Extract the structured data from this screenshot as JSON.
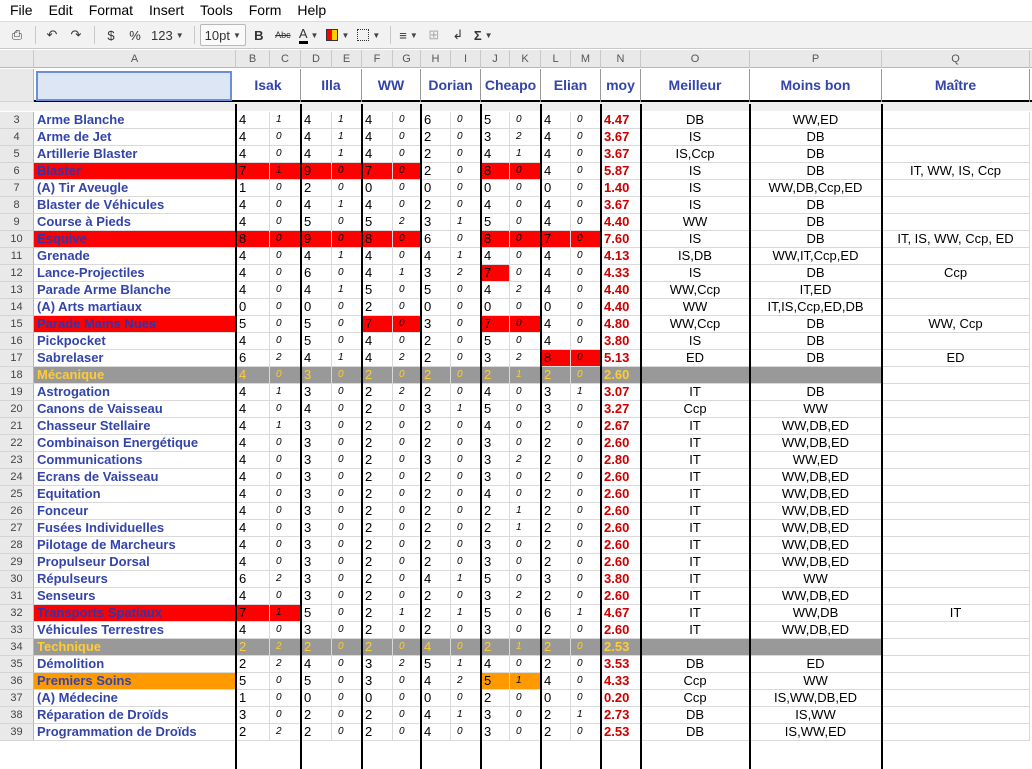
{
  "menu": [
    "File",
    "Edit",
    "Format",
    "Insert",
    "Tools",
    "Form",
    "Help"
  ],
  "toolbar": {
    "currency": "$",
    "percent": "%",
    "format": "123",
    "font_size": "10pt"
  },
  "columns": [
    "A",
    "B",
    "C",
    "D",
    "E",
    "F",
    "G",
    "H",
    "I",
    "J",
    "K",
    "L",
    "M",
    "N",
    "O",
    "P",
    "Q"
  ],
  "headers": {
    "isak": "Isak",
    "illa": "Illa",
    "ww": "WW",
    "dorian": "Dorian",
    "cheapo": "Cheapo",
    "elian": "Elian",
    "moy": "moy",
    "meilleur": "Meilleur",
    "moins_bon": "Moins bon",
    "maitre": "Maître"
  },
  "colors": {
    "red": "#ff0000",
    "gray": "#999999",
    "orange": "#ff9900",
    "name_blue": "#3344aa",
    "cat_yellow": "#ffcc33",
    "moy_red": "#cc0000"
  },
  "rows": [
    {
      "n": "3",
      "name": "Arme Blanche",
      "v": [
        "4",
        "1",
        "4",
        "1",
        "4",
        "0",
        "6",
        "0",
        "5",
        "0",
        "4",
        "0"
      ],
      "moy": "4.47",
      "best": "DB",
      "worst": "WW,ED",
      "master": ""
    },
    {
      "n": "4",
      "name": "Arme de Jet",
      "v": [
        "4",
        "0",
        "4",
        "1",
        "4",
        "0",
        "2",
        "0",
        "3",
        "2",
        "4",
        "0"
      ],
      "moy": "3.67",
      "best": "IS",
      "worst": "DB",
      "master": ""
    },
    {
      "n": "5",
      "name": "Artillerie Blaster",
      "v": [
        "4",
        "0",
        "4",
        "1",
        "4",
        "0",
        "2",
        "0",
        "4",
        "1",
        "4",
        "0"
      ],
      "moy": "3.67",
      "best": "IS,Ccp",
      "worst": "DB",
      "master": ""
    },
    {
      "n": "6",
      "name": "Blaster",
      "v": [
        "7",
        "1",
        "9",
        "0",
        "7",
        "0",
        "2",
        "0",
        "8",
        "0",
        "4",
        "0"
      ],
      "moy": "5.87",
      "best": "IS",
      "worst": "DB",
      "master": "IT, WW, IS, Ccp",
      "style": "red",
      "hl": [
        0,
        1,
        2,
        3,
        4,
        5,
        8,
        9
      ]
    },
    {
      "n": "7",
      "name": "(A) Tir Aveugle",
      "v": [
        "1",
        "0",
        "2",
        "0",
        "0",
        "0",
        "0",
        "0",
        "0",
        "0",
        "0",
        "0"
      ],
      "moy": "1.40",
      "best": "IS",
      "worst": "WW,DB,Ccp,ED",
      "master": ""
    },
    {
      "n": "8",
      "name": "Blaster de Véhicules",
      "v": [
        "4",
        "0",
        "4",
        "1",
        "4",
        "0",
        "2",
        "0",
        "4",
        "0",
        "4",
        "0"
      ],
      "moy": "3.67",
      "best": "IS",
      "worst": "DB",
      "master": ""
    },
    {
      "n": "9",
      "name": "Course à Pieds",
      "v": [
        "4",
        "0",
        "5",
        "0",
        "5",
        "2",
        "3",
        "1",
        "5",
        "0",
        "4",
        "0"
      ],
      "moy": "4.40",
      "best": "WW",
      "worst": "DB",
      "master": ""
    },
    {
      "n": "10",
      "name": "Esquive",
      "v": [
        "8",
        "0",
        "9",
        "0",
        "8",
        "0",
        "6",
        "0",
        "8",
        "0",
        "7",
        "0"
      ],
      "moy": "7.60",
      "best": "IS",
      "worst": "DB",
      "master": "IT, IS, WW, Ccp, ED",
      "style": "red",
      "hl": [
        0,
        1,
        2,
        3,
        4,
        5,
        8,
        9,
        10,
        11
      ]
    },
    {
      "n": "11",
      "name": "Grenade",
      "v": [
        "4",
        "0",
        "4",
        "1",
        "4",
        "0",
        "4",
        "1",
        "4",
        "0",
        "4",
        "0"
      ],
      "moy": "4.13",
      "best": "IS,DB",
      "worst": "WW,IT,Ccp,ED",
      "master": ""
    },
    {
      "n": "12",
      "name": "Lance-Projectiles",
      "v": [
        "4",
        "0",
        "6",
        "0",
        "4",
        "1",
        "3",
        "2",
        "7",
        "0",
        "4",
        "0"
      ],
      "moy": "4.33",
      "best": "IS",
      "worst": "DB",
      "master": "Ccp",
      "hl": [
        8
      ]
    },
    {
      "n": "13",
      "name": "Parade Arme Blanche",
      "v": [
        "4",
        "0",
        "4",
        "1",
        "5",
        "0",
        "5",
        "0",
        "4",
        "2",
        "4",
        "0"
      ],
      "moy": "4.40",
      "best": "WW,Ccp",
      "worst": "IT,ED",
      "master": ""
    },
    {
      "n": "14",
      "name": "(A) Arts martiaux",
      "v": [
        "0",
        "0",
        "0",
        "0",
        "2",
        "0",
        "0",
        "0",
        "0",
        "0",
        "0",
        "0"
      ],
      "moy": "4.40",
      "best": "WW",
      "worst": "IT,IS,Ccp,ED,DB",
      "master": ""
    },
    {
      "n": "15",
      "name": "Parade Mains Nues",
      "v": [
        "5",
        "0",
        "5",
        "0",
        "7",
        "0",
        "3",
        "0",
        "7",
        "0",
        "4",
        "0"
      ],
      "moy": "4.80",
      "best": "WW,Ccp",
      "worst": "DB",
      "master": "WW, Ccp",
      "style": "red",
      "hl": [
        4,
        5,
        8,
        9
      ]
    },
    {
      "n": "16",
      "name": "Pickpocket",
      "v": [
        "4",
        "0",
        "5",
        "0",
        "4",
        "0",
        "2",
        "0",
        "5",
        "0",
        "4",
        "0"
      ],
      "moy": "3.80",
      "best": "IS",
      "worst": "DB",
      "master": ""
    },
    {
      "n": "17",
      "name": "Sabrelaser",
      "v": [
        "6",
        "2",
        "4",
        "1",
        "4",
        "2",
        "2",
        "0",
        "3",
        "2",
        "8",
        "0"
      ],
      "moy": "5.13",
      "best": "ED",
      "worst": "DB",
      "master": "ED",
      "hl": [
        10,
        11
      ]
    },
    {
      "n": "18",
      "name": "Mécanique",
      "v": [
        "4",
        "0",
        "3",
        "0",
        "2",
        "0",
        "2",
        "0",
        "2",
        "1",
        "2",
        "0"
      ],
      "moy": "2.60",
      "best": "",
      "worst": "",
      "master": "",
      "style": "cat"
    },
    {
      "n": "19",
      "name": "Astrogation",
      "v": [
        "4",
        "1",
        "3",
        "0",
        "2",
        "2",
        "2",
        "0",
        "4",
        "0",
        "3",
        "1"
      ],
      "moy": "3.07",
      "best": "IT",
      "worst": "DB",
      "master": ""
    },
    {
      "n": "20",
      "name": "Canons de Vaisseau",
      "v": [
        "4",
        "0",
        "4",
        "0",
        "2",
        "0",
        "3",
        "1",
        "5",
        "0",
        "3",
        "0"
      ],
      "moy": "3.27",
      "best": "Ccp",
      "worst": "WW",
      "master": ""
    },
    {
      "n": "21",
      "name": "Chasseur Stellaire",
      "v": [
        "4",
        "1",
        "3",
        "0",
        "2",
        "0",
        "2",
        "0",
        "4",
        "0",
        "2",
        "0"
      ],
      "moy": "2.67",
      "best": "IT",
      "worst": "WW,DB,ED",
      "master": ""
    },
    {
      "n": "22",
      "name": "Combinaison Energétique",
      "v": [
        "4",
        "0",
        "3",
        "0",
        "2",
        "0",
        "2",
        "0",
        "3",
        "0",
        "2",
        "0"
      ],
      "moy": "2.60",
      "best": "IT",
      "worst": "WW,DB,ED",
      "master": ""
    },
    {
      "n": "23",
      "name": "Communications",
      "v": [
        "4",
        "0",
        "3",
        "0",
        "2",
        "0",
        "3",
        "0",
        "3",
        "2",
        "2",
        "0"
      ],
      "moy": "2.80",
      "best": "IT",
      "worst": "WW,ED",
      "master": ""
    },
    {
      "n": "24",
      "name": "Ecrans de Vaisseau",
      "v": [
        "4",
        "0",
        "3",
        "0",
        "2",
        "0",
        "2",
        "0",
        "3",
        "0",
        "2",
        "0"
      ],
      "moy": "2.60",
      "best": "IT",
      "worst": "WW,DB,ED",
      "master": ""
    },
    {
      "n": "25",
      "name": "Equitation",
      "v": [
        "4",
        "0",
        "3",
        "0",
        "2",
        "0",
        "2",
        "0",
        "4",
        "0",
        "2",
        "0"
      ],
      "moy": "2.60",
      "best": "IT",
      "worst": "WW,DB,ED",
      "master": ""
    },
    {
      "n": "26",
      "name": "Fonceur",
      "v": [
        "4",
        "0",
        "3",
        "0",
        "2",
        "0",
        "2",
        "0",
        "2",
        "1",
        "2",
        "0"
      ],
      "moy": "2.60",
      "best": "IT",
      "worst": "WW,DB,ED",
      "master": ""
    },
    {
      "n": "27",
      "name": "Fusées Individuelles",
      "v": [
        "4",
        "0",
        "3",
        "0",
        "2",
        "0",
        "2",
        "0",
        "2",
        "1",
        "2",
        "0"
      ],
      "moy": "2.60",
      "best": "IT",
      "worst": "WW,DB,ED",
      "master": ""
    },
    {
      "n": "28",
      "name": "Pilotage de Marcheurs",
      "v": [
        "4",
        "0",
        "3",
        "0",
        "2",
        "0",
        "2",
        "0",
        "3",
        "0",
        "2",
        "0"
      ],
      "moy": "2.60",
      "best": "IT",
      "worst": "WW,DB,ED",
      "master": ""
    },
    {
      "n": "29",
      "name": "Propulseur Dorsal",
      "v": [
        "4",
        "0",
        "3",
        "0",
        "2",
        "0",
        "2",
        "0",
        "3",
        "0",
        "2",
        "0"
      ],
      "moy": "2.60",
      "best": "IT",
      "worst": "WW,DB,ED",
      "master": ""
    },
    {
      "n": "30",
      "name": "Répulseurs",
      "v": [
        "6",
        "2",
        "3",
        "0",
        "2",
        "0",
        "4",
        "1",
        "5",
        "0",
        "3",
        "0"
      ],
      "moy": "3.80",
      "best": "IT",
      "worst": "WW",
      "master": ""
    },
    {
      "n": "31",
      "name": "Senseurs",
      "v": [
        "4",
        "0",
        "3",
        "0",
        "2",
        "0",
        "2",
        "0",
        "3",
        "2",
        "2",
        "0"
      ],
      "moy": "2.60",
      "best": "IT",
      "worst": "WW,DB,ED",
      "master": ""
    },
    {
      "n": "32",
      "name": "Transports Spatiaux",
      "v": [
        "7",
        "1",
        "5",
        "0",
        "2",
        "1",
        "2",
        "1",
        "5",
        "0",
        "6",
        "1"
      ],
      "moy": "4.67",
      "best": "IT",
      "worst": "WW,DB",
      "master": "IT",
      "style": "red",
      "hl": [
        0,
        1
      ]
    },
    {
      "n": "33",
      "name": "Véhicules Terrestres",
      "v": [
        "4",
        "0",
        "3",
        "0",
        "2",
        "0",
        "2",
        "0",
        "3",
        "0",
        "2",
        "0"
      ],
      "moy": "2.60",
      "best": "IT",
      "worst": "WW,DB,ED",
      "master": ""
    },
    {
      "n": "34",
      "name": "Technique",
      "v": [
        "2",
        "2",
        "2",
        "0",
        "2",
        "0",
        "4",
        "0",
        "2",
        "1",
        "2",
        "0"
      ],
      "moy": "2.53",
      "best": "",
      "worst": "",
      "master": "",
      "style": "cat"
    },
    {
      "n": "35",
      "name": "Démolition",
      "v": [
        "2",
        "2",
        "4",
        "0",
        "3",
        "2",
        "5",
        "1",
        "4",
        "0",
        "2",
        "0"
      ],
      "moy": "3.53",
      "best": "DB",
      "worst": "ED",
      "master": ""
    },
    {
      "n": "36",
      "name": "Premiers Soins",
      "v": [
        "5",
        "0",
        "5",
        "0",
        "3",
        "0",
        "4",
        "2",
        "5",
        "1",
        "4",
        "0"
      ],
      "moy": "4.33",
      "best": "Ccp",
      "worst": "WW",
      "master": "",
      "style": "orange",
      "hl_orange": [
        8,
        9
      ]
    },
    {
      "n": "37",
      "name": "(A) Médecine",
      "v": [
        "1",
        "0",
        "0",
        "0",
        "0",
        "0",
        "0",
        "0",
        "2",
        "0",
        "0",
        "0"
      ],
      "moy": "0.20",
      "best": "Ccp",
      "worst": "IS,WW,DB,ED",
      "master": ""
    },
    {
      "n": "38",
      "name": "Réparation de Droïds",
      "v": [
        "3",
        "0",
        "2",
        "0",
        "2",
        "0",
        "4",
        "1",
        "3",
        "0",
        "2",
        "1"
      ],
      "moy": "2.73",
      "best": "DB",
      "worst": "IS,WW",
      "master": ""
    },
    {
      "n": "39",
      "name": "Programmation de Droïds",
      "v": [
        "2",
        "2",
        "2",
        "0",
        "2",
        "0",
        "4",
        "0",
        "3",
        "0",
        "2",
        "0"
      ],
      "moy": "2.53",
      "best": "DB",
      "worst": "IS,WW,ED",
      "master": ""
    }
  ]
}
